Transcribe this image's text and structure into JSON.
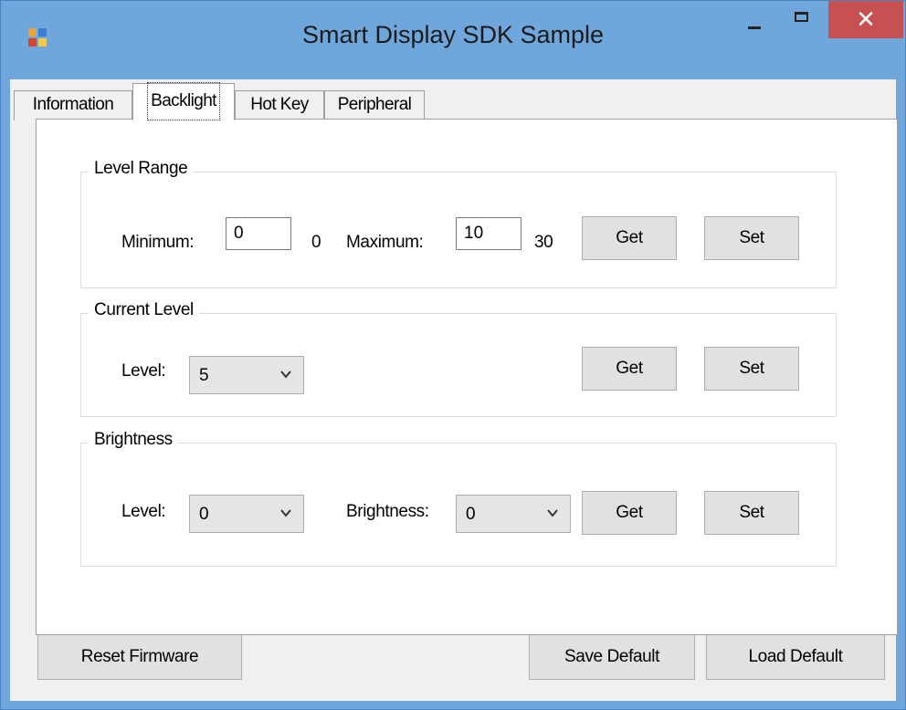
{
  "window": {
    "title": "Smart Display SDK Sample",
    "close_glyph": "✕"
  },
  "tabs": [
    {
      "label": "Information"
    },
    {
      "label": "Backlight"
    },
    {
      "label": "Hot Key"
    },
    {
      "label": "Peripheral"
    }
  ],
  "level_range": {
    "title": "Level Range",
    "min_label": "Minimum:",
    "min_value": "0",
    "min_readout": "0",
    "max_label": "Maximum:",
    "max_value": "10",
    "max_readout": "30",
    "get_label": "Get",
    "set_label": "Set"
  },
  "current_level": {
    "title": "Current Level",
    "level_label": "Level:",
    "level_value": "5",
    "get_label": "Get",
    "set_label": "Set"
  },
  "brightness": {
    "title": "Brightness",
    "level_label": "Level:",
    "level_value": "0",
    "brightness_label": "Brightness:",
    "brightness_value": "0",
    "get_label": "Get",
    "set_label": "Set"
  },
  "footer": {
    "reset_label": "Reset Firmware",
    "save_label": "Save Default",
    "load_label": "Load Default"
  },
  "colors": {
    "frame": "#6fa7dc",
    "close_button": "#c75050",
    "client_bg": "#f0f0f0",
    "button_bg": "#e1e1e1"
  }
}
